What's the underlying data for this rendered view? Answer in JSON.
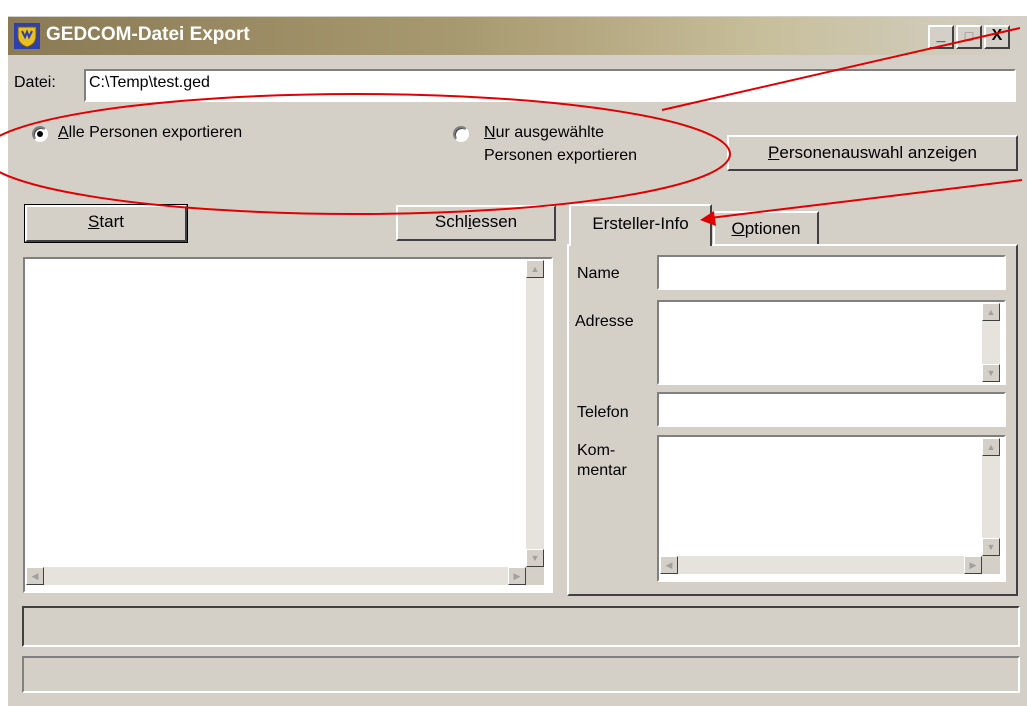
{
  "window": {
    "title": "GEDCOM-Datei Export",
    "minimize": "_",
    "maximize": "□",
    "close": "X"
  },
  "file": {
    "label": "Datei:",
    "value": "C:\\Temp\\test.ged"
  },
  "export_options": {
    "all_first": "A",
    "all_rest": "lle Personen exportieren",
    "selected_first": "N",
    "selected_line1_rest": "ur ausgewählte",
    "selected_line2": "Personen exportieren",
    "selected": "all"
  },
  "buttons": {
    "show_selection_first": "P",
    "show_selection_rest": "ersonenauswahl anzeigen",
    "start_first": "S",
    "start_rest": "tart",
    "close_pre": "Schl",
    "close_key": "i",
    "close_post": "essen"
  },
  "tabs": {
    "creator_info": "Ersteller-Info",
    "options_first": "O",
    "options_rest": "ptionen"
  },
  "creator_form": {
    "name_label": "Name",
    "address_label": "Adresse",
    "phone_label": "Telefon",
    "comment_label_line1": "Kom-",
    "comment_label_line2": "mentar"
  },
  "scroll_arrows": {
    "up": "▲",
    "down": "▼",
    "left": "◀",
    "right": "▶"
  },
  "annotation": {
    "color": "#e00000"
  }
}
